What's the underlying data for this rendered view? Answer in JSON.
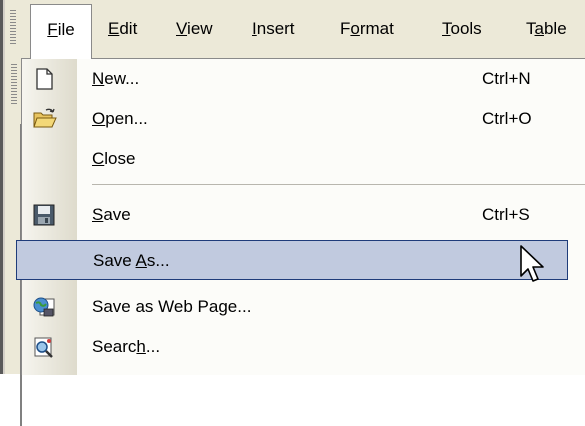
{
  "menubar": {
    "items": [
      {
        "label": "File",
        "accel": "F"
      },
      {
        "label": "Edit",
        "accel": "E"
      },
      {
        "label": "View",
        "accel": "V"
      },
      {
        "label": "Insert",
        "accel": "I"
      },
      {
        "label": "Format",
        "accel": "o"
      },
      {
        "label": "Tools",
        "accel": "T"
      },
      {
        "label": "Table",
        "accel": "a"
      }
    ]
  },
  "file_menu": {
    "items": [
      {
        "label": "New...",
        "shortcut": "Ctrl+N",
        "icon": "new-document-icon"
      },
      {
        "label": "Open...",
        "shortcut": "Ctrl+O",
        "icon": "open-folder-icon"
      },
      {
        "label": "Close",
        "shortcut": "",
        "icon": ""
      },
      {
        "label": "Save",
        "shortcut": "Ctrl+S",
        "icon": "floppy-disk-icon"
      },
      {
        "label": "Save As...",
        "shortcut": "",
        "icon": "",
        "highlighted": true
      },
      {
        "label": "Save as Web Page...",
        "shortcut": "",
        "icon": "web-page-icon"
      },
      {
        "label": "Search...",
        "shortcut": "",
        "icon": "search-icon"
      }
    ]
  },
  "colors": {
    "menubar_bg": "#ece9d8",
    "highlight_bg": "#c1cadf",
    "highlight_border": "#1f3c7a"
  }
}
